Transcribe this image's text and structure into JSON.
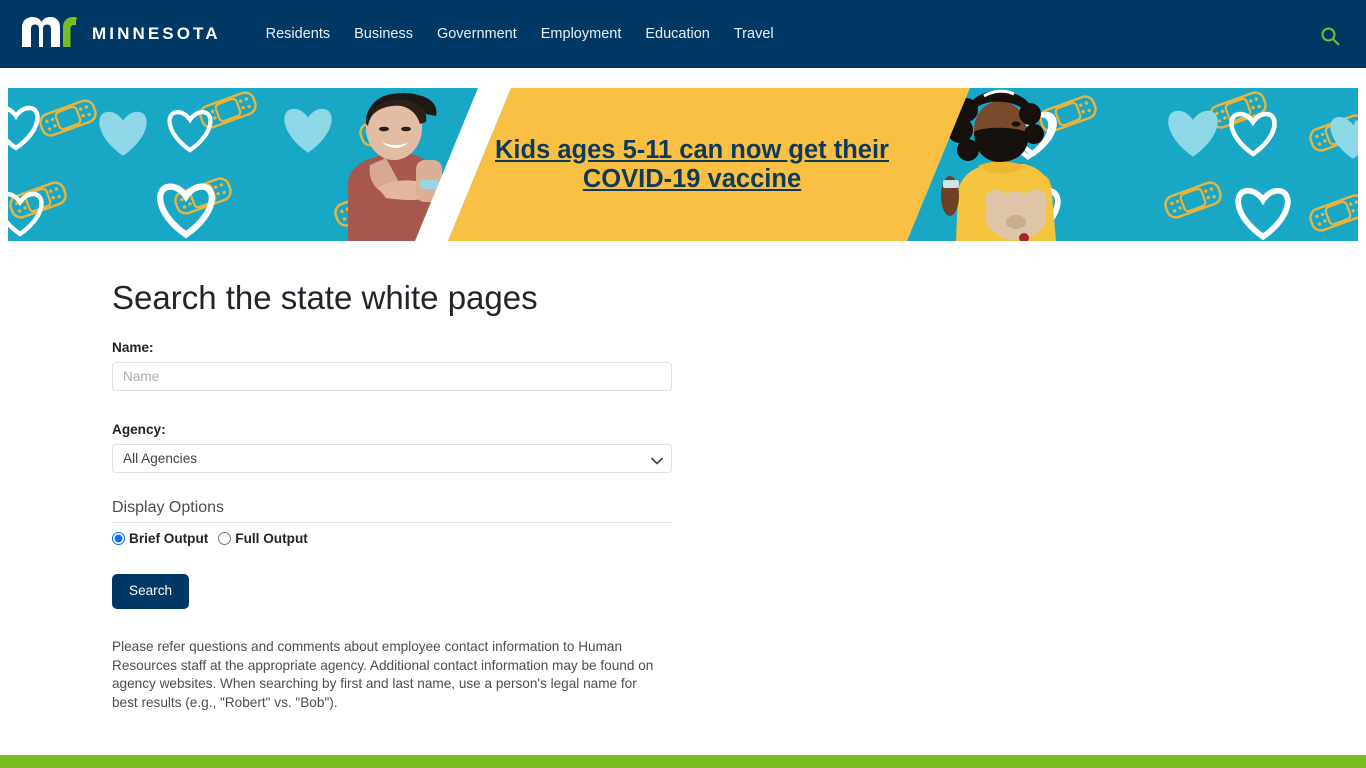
{
  "header": {
    "logo": {
      "mark_name": "mn-logo",
      "wordmark": "MINNESOTA"
    },
    "nav_items": [
      {
        "label": "Residents"
      },
      {
        "label": "Business"
      },
      {
        "label": "Government"
      },
      {
        "label": "Employment"
      },
      {
        "label": "Education"
      },
      {
        "label": "Travel"
      }
    ],
    "search_icon": "search-icon",
    "background_color": "#003865",
    "search_icon_color": "#78be21"
  },
  "banner": {
    "headline": "Kids ages 5-11 can now get their COVID-19 vaccine",
    "teal_color": "#18a8c6",
    "yellow_color": "#f9c043",
    "text_color": "#0e3a5c",
    "left_photo_alt": "Boy in red shirt and cap showing bandage on arm",
    "right_photo_alt": "Girl in yellow dress wearing mask holding stuffed dog"
  },
  "main": {
    "page_title": "Search the state white pages",
    "name_field": {
      "label": "Name:",
      "placeholder": "Name",
      "value": ""
    },
    "agency_field": {
      "label": "Agency:",
      "selected": "All Agencies",
      "options": [
        "All Agencies"
      ]
    },
    "display_options": {
      "legend": "Display Options",
      "radios": [
        {
          "label": "Brief Output",
          "checked": true
        },
        {
          "label": "Full Output",
          "checked": false
        }
      ]
    },
    "search_button": {
      "label": "Search",
      "color": "#003865"
    },
    "help_text": "Please refer questions and comments about employee contact information to Human Resources staff at the appropriate agency. Additional contact information may be found on agency websites. When searching by first and last name, use a person's legal name for best results (e.g., \"Robert\" vs. \"Bob\")."
  },
  "footer": {
    "accent_color": "#78be21"
  }
}
